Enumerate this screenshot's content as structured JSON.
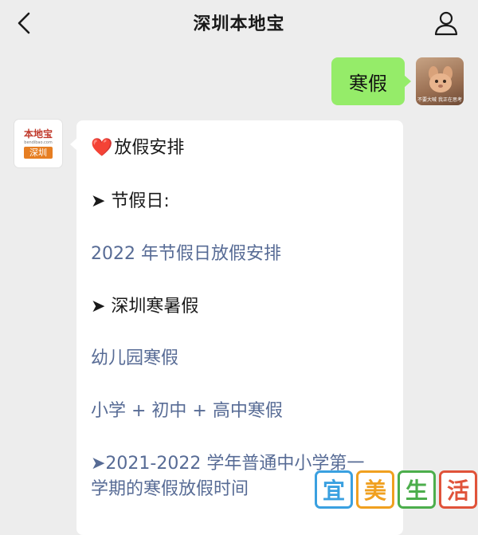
{
  "header": {
    "title": "深圳本地宝"
  },
  "outgoing": {
    "text": "寒假",
    "avatar_caption": "不要大喊 我正在思考"
  },
  "incoming": {
    "logo": {
      "top": "本地宝",
      "url": "bendibao.com",
      "city": "深圳"
    },
    "lines": [
      {
        "text": "放假安排",
        "prefix": "❤️",
        "link": false
      },
      {
        "text": "➤ 节假日:",
        "link": false
      },
      {
        "text": "2022 年节假日放假安排",
        "link": true
      },
      {
        "text": "➤ 深圳寒暑假",
        "link": false
      },
      {
        "text": "幼儿园寒假",
        "link": true
      },
      {
        "text": "小学 + 初中 + 高中寒假",
        "link": true
      },
      {
        "text": "➤2021-2022 学年普通中小学第一",
        "link": true
      },
      {
        "text": "学期的寒假放假时间",
        "link": true
      }
    ]
  },
  "watermark": {
    "chars": [
      "宜",
      "美",
      "生",
      "活"
    ],
    "colors": [
      "#3aa0e0",
      "#f0a020",
      "#4cae4c",
      "#e0533a"
    ]
  },
  "colors": {
    "bubble_out": "#95ec69",
    "link": "#576b95",
    "background": "#ededed"
  }
}
